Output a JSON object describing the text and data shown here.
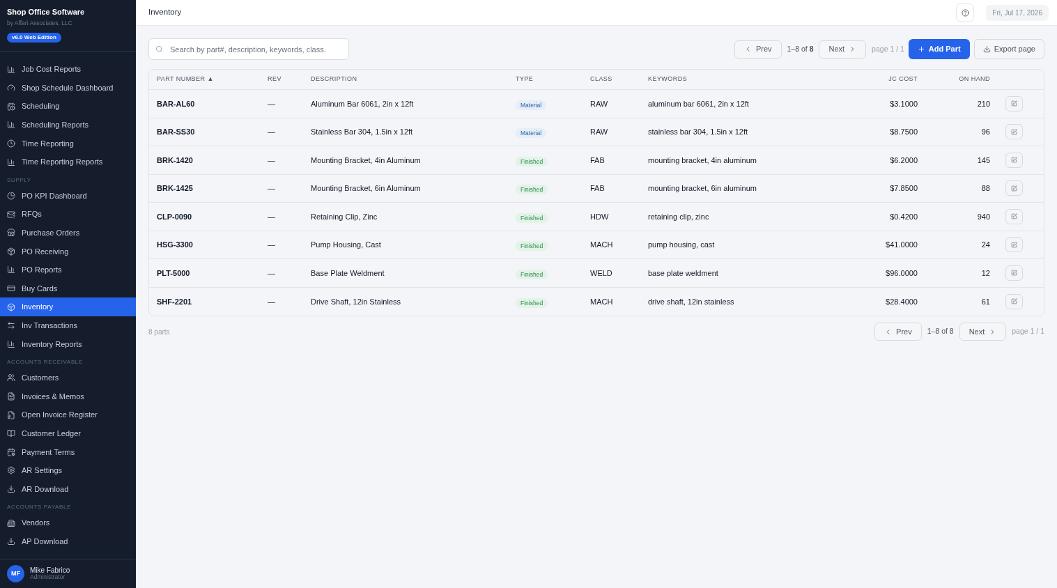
{
  "brand": {
    "title": "Shop Office Software",
    "subtitle": "by Affari Associates, LLC",
    "edition": "v6.0 Web Edition"
  },
  "sidebar": {
    "items": [
      {
        "kind": "item",
        "label": "Job Cost Reports",
        "selected": false
      },
      {
        "kind": "item",
        "label": "Shop Schedule Dashboard",
        "selected": false
      },
      {
        "kind": "item",
        "label": "Scheduling",
        "selected": false
      },
      {
        "kind": "item",
        "label": "Scheduling Reports",
        "selected": false
      },
      {
        "kind": "item",
        "label": "Time Reporting",
        "selected": false
      },
      {
        "kind": "item",
        "label": "Time Reporting Reports",
        "selected": false
      },
      {
        "kind": "heading",
        "label": "SUPPLY"
      },
      {
        "kind": "item",
        "label": "PO KPI Dashboard",
        "selected": false
      },
      {
        "kind": "item",
        "label": "RFQs",
        "selected": false
      },
      {
        "kind": "item",
        "label": "Purchase Orders",
        "selected": false
      },
      {
        "kind": "item",
        "label": "PO Receiving",
        "selected": false
      },
      {
        "kind": "item",
        "label": "PO Reports",
        "selected": false
      },
      {
        "kind": "item",
        "label": "Buy Cards",
        "selected": false
      },
      {
        "kind": "item",
        "label": "Inventory",
        "selected": true
      },
      {
        "kind": "item",
        "label": "Inv Transactions",
        "selected": false
      },
      {
        "kind": "item",
        "label": "Inventory Reports",
        "selected": false
      },
      {
        "kind": "heading",
        "label": "ACCOUNTS RECEIVABLE"
      },
      {
        "kind": "item",
        "label": "Customers",
        "selected": false
      },
      {
        "kind": "item",
        "label": "Invoices & Memos",
        "selected": false
      },
      {
        "kind": "item",
        "label": "Open Invoice Register",
        "selected": false
      },
      {
        "kind": "item",
        "label": "Customer Ledger",
        "selected": false
      },
      {
        "kind": "item",
        "label": "Payment Terms",
        "selected": false
      },
      {
        "kind": "item",
        "label": "AR Settings",
        "selected": false
      },
      {
        "kind": "item",
        "label": "AR Download",
        "selected": false
      },
      {
        "kind": "heading",
        "label": "ACCOUNTS PAYABLE"
      },
      {
        "kind": "item",
        "label": "Vendors",
        "selected": false
      },
      {
        "kind": "item",
        "label": "AP Download",
        "selected": false
      }
    ]
  },
  "user": {
    "initials": "MF",
    "name": "Mike Fabrico",
    "role": "Administrator"
  },
  "header": {
    "title": "Inventory",
    "date": "Fri, Jul 17, 2026"
  },
  "toolbar": {
    "search": {
      "placeholder": "Search by part#, description, keywords, class."
    },
    "prev": "Prev",
    "range": "1–8 of **8**",
    "next": "Next",
    "page": "page 1 / 1",
    "add": "Add Part",
    "export": "Export page"
  },
  "table": {
    "columns": [
      "PART NUMBER ▲",
      "REV",
      "DESCRIPTION",
      "TYPE",
      "CLASS",
      "KEYWORDS",
      "JC COST",
      "ON HAND"
    ],
    "rows": [
      {
        "part": "BAR-AL60",
        "rev": "—",
        "description": "Aluminum Bar 6061, 2in x 12ft",
        "type": {
          "label": "Material",
          "kind": "material"
        },
        "class": "RAW",
        "keywords": "aluminum bar 6061, 2in x 12ft",
        "cost": "$3.1000",
        "on_hand": "210"
      },
      {
        "part": "BAR-SS30",
        "rev": "—",
        "description": "Stainless Bar 304, 1.5in x 12ft",
        "type": {
          "label": "Material",
          "kind": "material"
        },
        "class": "RAW",
        "keywords": "stainless bar 304, 1.5in x 12ft",
        "cost": "$8.7500",
        "on_hand": "96"
      },
      {
        "part": "BRK-1420",
        "rev": "—",
        "description": "Mounting Bracket, 4in Aluminum",
        "type": {
          "label": "Finished",
          "kind": "finished"
        },
        "class": "FAB",
        "keywords": "mounting bracket, 4in aluminum",
        "cost": "$6.2000",
        "on_hand": "145"
      },
      {
        "part": "BRK-1425",
        "rev": "—",
        "description": "Mounting Bracket, 6in Aluminum",
        "type": {
          "label": "Finished",
          "kind": "finished"
        },
        "class": "FAB",
        "keywords": "mounting bracket, 6in aluminum",
        "cost": "$7.8500",
        "on_hand": "88"
      },
      {
        "part": "CLP-0090",
        "rev": "—",
        "description": "Retaining Clip, Zinc",
        "type": {
          "label": "Finished",
          "kind": "finished"
        },
        "class": "HDW",
        "keywords": "retaining clip, zinc",
        "cost": "$0.4200",
        "on_hand": "940"
      },
      {
        "part": "HSG-3300",
        "rev": "—",
        "description": "Pump Housing, Cast",
        "type": {
          "label": "Finished",
          "kind": "finished"
        },
        "class": "MACH",
        "keywords": "pump housing, cast",
        "cost": "$41.0000",
        "on_hand": "24"
      },
      {
        "part": "PLT-5000",
        "rev": "—",
        "description": "Base Plate Weldment",
        "type": {
          "label": "Finished",
          "kind": "finished"
        },
        "class": "WELD",
        "keywords": "base plate weldment",
        "cost": "$96.0000",
        "on_hand": "12"
      },
      {
        "part": "SHF-2201",
        "rev": "—",
        "description": "Drive Shaft, 12in Stainless",
        "type": {
          "label": "Finished",
          "kind": "finished"
        },
        "class": "MACH",
        "keywords": "drive shaft, 12in stainless",
        "cost": "$28.4000",
        "on_hand": "61"
      }
    ]
  },
  "footer": {
    "count": "8 parts",
    "prev": "Prev",
    "range": "1–8 of 8",
    "next": "Next",
    "page": "page 1 / 1"
  }
}
